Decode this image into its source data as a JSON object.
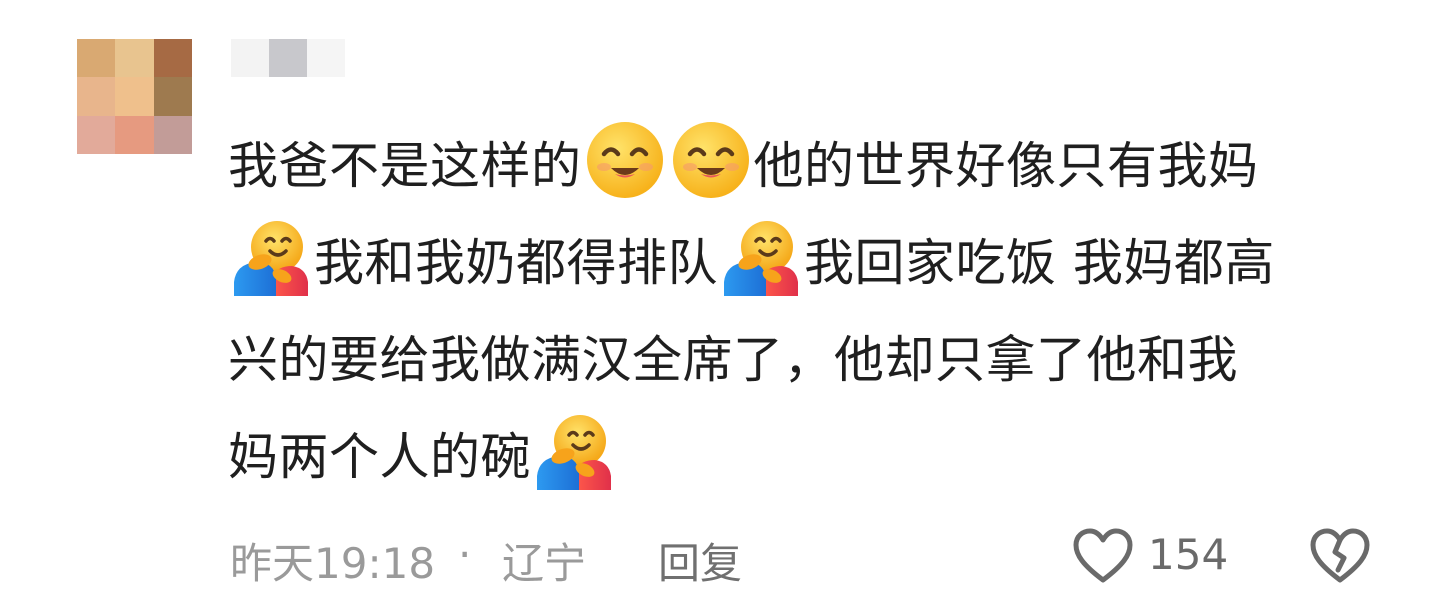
{
  "comment": {
    "lines": [
      [
        {
          "t": "text",
          "v": "我爸不是这样的"
        },
        {
          "t": "emoji",
          "icon": "smiling-face-icon"
        },
        {
          "t": "emoji",
          "icon": "smiling-face-icon"
        },
        {
          "t": "text",
          "v": "他的世界好像只有我妈"
        }
      ],
      [
        {
          "t": "emoji",
          "icon": "hugging-face-icon"
        },
        {
          "t": "text",
          "v": "我和我奶都得排队"
        },
        {
          "t": "emoji",
          "icon": "hugging-face-icon"
        },
        {
          "t": "text",
          "v": "我回家吃饭 我妈都高"
        }
      ],
      [
        {
          "t": "text",
          "v": "兴的要给我做满汉全席了，他却只拿了他和我"
        }
      ],
      [
        {
          "t": "text",
          "v": "妈两个人的碗"
        },
        {
          "t": "emoji",
          "icon": "hugging-face-icon"
        }
      ]
    ]
  },
  "footer": {
    "time": "昨天19:18",
    "separator": "·",
    "location": "辽宁",
    "reply_label": "回复",
    "like_count": "154"
  },
  "icons": {
    "like": "heart-outline-icon",
    "dislike": "broken-heart-outline-icon"
  },
  "colors": {
    "text": "#1f1f1f",
    "meta": "#9a9a9a",
    "avatar_blur": [
      "#d9a972",
      "#e8c48f",
      "#a66a44",
      "#e8b58c",
      "#efc08c",
      "#9e7a4f",
      "#e2aa9a",
      "#e69a80",
      "#c29c98"
    ],
    "username_blur": [
      "#f3f3f3",
      "#c8c8cc",
      "#f5f5f5"
    ]
  }
}
